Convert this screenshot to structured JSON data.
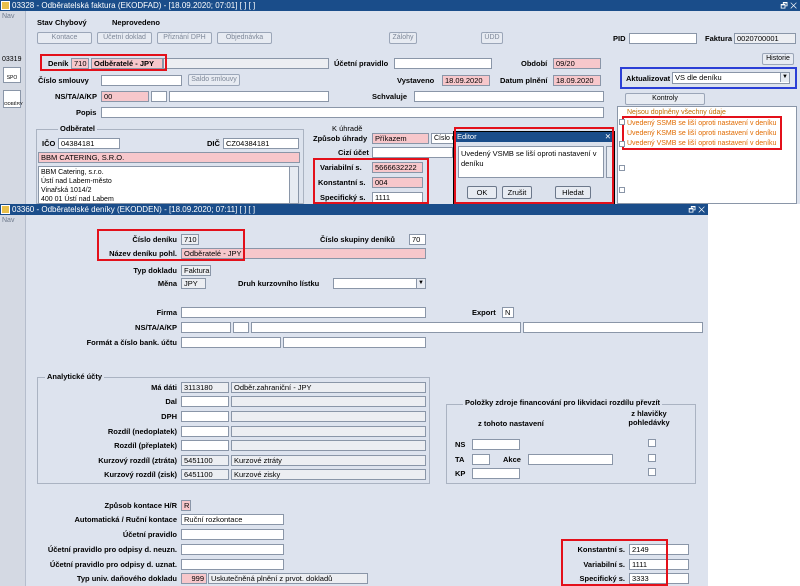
{
  "win1": {
    "title": "03328 - Odběratelská faktura (EKODFAD) - [18.09.2020; 07:01] [ ] [ ]",
    "nav": "Nav",
    "side_nums": [
      "03319"
    ],
    "side_icons": [
      "SPO",
      "ODBĚRY"
    ],
    "stav_label": "Stav",
    "stav_value": "Chybový",
    "neprovedeno": "Neprovedeno",
    "buttons": [
      "Kontace",
      "Účetní doklad",
      "Přiznání DPH",
      "Objednávka",
      "Zálohy",
      "ÚDD"
    ],
    "pid_label": "PID",
    "faktura_label": "Faktura",
    "faktura_value": "0020700001",
    "historie": "Historie",
    "denik_label": "Deník",
    "denik_code": "710",
    "denik_name": "Odběratelé - JPY",
    "ucetni_pravidlo": "Účetní pravidlo",
    "obdobi_label": "Období",
    "obdobi_value": "09/20",
    "cislo_smlouvy": "Číslo smlouvy",
    "saldo_smlouvy": "Saldo smlouvy",
    "vystaveno_label": "Vystaveno",
    "vystaveno_value": "18.09.2020",
    "datum_plneni_label": "Datum plnění",
    "datum_plneni_value": "18.09.2020",
    "aktualizovat_label": "Aktualizovat",
    "aktualizovat_value": "VS dle deníku",
    "ns_label": "NS/TA/A/KP",
    "ns_value": "00",
    "schvaluje": "Schvaluje",
    "popis": "Popis",
    "kontroly": "Kontroly",
    "warnings": [
      "Nejsou doplněny všechny údaje",
      "Uvedený SSMB se liší oproti nastavení v deníku",
      "Uvedený KSMB se liší oproti nastavení v deníku",
      "Uvedený VSMB se liší oproti nastavení v deníku"
    ],
    "odberatel_title": "Odběratel",
    "ico_label": "IČO",
    "ico_value": "04384181",
    "dic_label": "DIČ",
    "dic_value": "CZ04384181",
    "firma_name": "BBM CATERING, S.R.O.",
    "address_lines": [
      "BBM Catering, s.r.o.",
      "Ústí nad Labem-město",
      "Vinařská 1014/2",
      "400 01 Ústí nad Labem"
    ],
    "k_uhrade": "K úhradě",
    "zpusob_uhrady_label": "Způsob úhrady",
    "zpusob_uhrady_value": "Příkazem",
    "cislo_uctu_short": "Číslo ú",
    "cizi_ucet": "Cizí účet",
    "variabilni_label": "Variabilní s.",
    "variabilni_value": "5666632222",
    "konstantni_label": "Konstantní s.",
    "konstantni_value": "004",
    "specificky_label": "Specifický s.",
    "specificky_value": "1111"
  },
  "editor": {
    "title": "Editor",
    "text": "Uvedený VSMB se liší oproti nastavení v deníku",
    "ok": "OK",
    "zrusit": "Zrušit",
    "hledat": "Hledat"
  },
  "win2": {
    "title": "03360 - Odběratelské deníky (EKODDEN) - [18.09.2020; 07:11] [ ] [ ]",
    "nav": "Nav",
    "cislo_deniku_label": "Číslo deníku",
    "cislo_deniku_value": "710",
    "nazev_label": "Název deníku pohl.",
    "nazev_value": "Odběratelé - JPY",
    "cislo_skupiny_label": "Číslo skupiny deníků",
    "cislo_skupiny_value": "70",
    "typ_dokladu_label": "Typ dokladu",
    "typ_dokladu_value": "Faktura",
    "mena_label": "Měna",
    "mena_value": "JPY",
    "druh_kurz_label": "Druh kurzovního lístku",
    "firma_label": "Firma",
    "export_label": "Export",
    "export_value": "N",
    "ns_label": "NS/TA/A/KP",
    "format_label": "Formát a číslo bank. účtu",
    "analyticke_title": "Analytické účty",
    "ma_dati_label": "Má dáti",
    "ma_dati_value": "3113180",
    "ma_dati_desc": "Odběr.zahraniční - JPY",
    "dal_label": "Dal",
    "dph_label": "DPH",
    "rozdil_ned_label": "Rozdíl (nedoplatek)",
    "rozdil_pre_label": "Rozdíl (přeplatek)",
    "kurz_ztrata_label": "Kurzový rozdíl (ztráta)",
    "kurz_ztrata_value": "5451100",
    "kurz_ztrata_desc": "Kurzové ztráty",
    "kurz_zisk_label": "Kurzový rozdíl (zisk)",
    "kurz_zisk_value": "6451100",
    "kurz_zisk_desc": "Kurzové zisky",
    "polozky_title": "Položky zdroje financování pro likvidaci rozdílu převzít",
    "z_tohoto": "z tohoto nastavení",
    "z_hlavicky": "z hlavičky pohledávky",
    "ns_short": "NS",
    "ta_short": "TA",
    "akce_label": "Akce",
    "kp_short": "KP",
    "zpusob_kontace_label": "Způsob kontace H/R",
    "zpusob_kontace_value": "R",
    "automaticka_label": "Automatická / Ruční kontace",
    "automaticka_value": "Ruční rozkontace",
    "ucetni_pravidlo_label": "Účetní pravidlo",
    "odpis_neuzn_label": "Účetní pravidlo pro odpisy d. neuzn.",
    "odpis_uzn_label": "Účetní pravidlo pro odpisy d. uznat.",
    "typ_univ_label": "Typ univ. daňového dokladu",
    "typ_univ_code": "999",
    "typ_univ_desc": "Uskutečněná plnění z prvot. dokladů",
    "konstantni_label": "Konstantní s.",
    "konstantni_value": "2149",
    "variabilni_label": "Variabilní s.",
    "variabilni_value": "1111",
    "specificky_label": "Specifický s.",
    "specificky_value": "3333"
  },
  "colors": {
    "titlebar": "#1a4d8a",
    "highlight_red": "#e3101a",
    "highlight_blue": "#2b3fd6",
    "pink_field": "#f7c7cb",
    "warning_orange": "#e06a00"
  }
}
